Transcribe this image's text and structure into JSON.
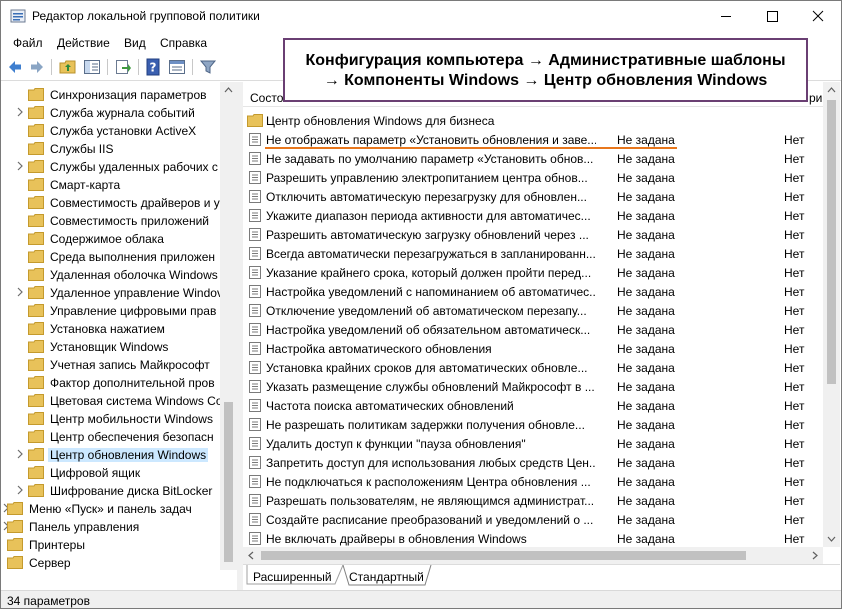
{
  "window": {
    "title": "Редактор локальной групповой политики",
    "minimize": "—",
    "maximize": "☐",
    "close": "✕"
  },
  "menu": [
    "Файл",
    "Действие",
    "Вид",
    "Справка"
  ],
  "annotation": {
    "line1": "Конфигурация компьютера → Административные шаблоны",
    "line2": "→ Компоненты Windows → Центр обновления Windows"
  },
  "tree": [
    {
      "label": "Синхронизация параметров",
      "expandable": false,
      "level": 2
    },
    {
      "label": "Служба журнала событий",
      "expandable": true,
      "level": 2
    },
    {
      "label": "Служба установки ActiveX",
      "expandable": false,
      "level": 2
    },
    {
      "label": "Службы IIS",
      "expandable": false,
      "level": 2
    },
    {
      "label": "Службы удаленных рабочих с",
      "expandable": true,
      "level": 2
    },
    {
      "label": "Смарт-карта",
      "expandable": false,
      "level": 2
    },
    {
      "label": "Совместимость драйверов и ус",
      "expandable": false,
      "level": 2
    },
    {
      "label": "Совместимость приложений",
      "expandable": false,
      "level": 2
    },
    {
      "label": "Содержимое облака",
      "expandable": false,
      "level": 2
    },
    {
      "label": "Среда выполнения приложен",
      "expandable": false,
      "level": 2
    },
    {
      "label": "Удаленная оболочка Windows",
      "expandable": false,
      "level": 2
    },
    {
      "label": "Удаленное управление Windov",
      "expandable": true,
      "level": 2
    },
    {
      "label": "Управление цифровыми прав",
      "expandable": false,
      "level": 2
    },
    {
      "label": "Установка нажатием",
      "expandable": false,
      "level": 2
    },
    {
      "label": "Установщик Windows",
      "expandable": false,
      "level": 2
    },
    {
      "label": "Учетная запись Майкрософт",
      "expandable": false,
      "level": 2
    },
    {
      "label": "Фактор дополнительной пров",
      "expandable": false,
      "level": 2
    },
    {
      "label": "Цветовая система Windows Co",
      "expandable": false,
      "level": 2
    },
    {
      "label": "Центр мобильности Windows",
      "expandable": false,
      "level": 2
    },
    {
      "label": "Центр обеспечения безопасн",
      "expandable": false,
      "level": 2
    },
    {
      "label": "Центр обновления Windows",
      "expandable": true,
      "level": 2,
      "selected": true
    },
    {
      "label": "Цифровой ящик",
      "expandable": false,
      "level": 2
    },
    {
      "label": "Шифрование диска BitLocker",
      "expandable": true,
      "level": 2
    },
    {
      "label": "Меню «Пуск» и панель задач",
      "expandable": true,
      "level": 1
    },
    {
      "label": "Панель управления",
      "expandable": true,
      "level": 1
    },
    {
      "label": "Принтеры",
      "expandable": false,
      "level": 1
    },
    {
      "label": "Сервер",
      "expandable": false,
      "level": 1
    }
  ],
  "list": {
    "headers": {
      "name": "Состо",
      "state": "",
      "comment": "ри"
    },
    "folder_row": "Центр обновления Windows для бизнеса",
    "rows": [
      {
        "name": "Не отображать параметр «Установить обновления и заве...",
        "state": "Не задана",
        "comment": "Нет"
      },
      {
        "name": "Не задавать по умолчанию параметр «Установить обнов...",
        "state": "Не задана",
        "comment": "Нет"
      },
      {
        "name": "Разрешить управлению электропитанием центра обнов...",
        "state": "Не задана",
        "comment": "Нет"
      },
      {
        "name": "Отключить автоматическую перезагрузку для обновлен...",
        "state": "Не задана",
        "comment": "Нет"
      },
      {
        "name": "Укажите диапазон периода активности для автоматичес...",
        "state": "Не задана",
        "comment": "Нет"
      },
      {
        "name": "Разрешить автоматическую загрузку обновлений через ...",
        "state": "Не задана",
        "comment": "Нет"
      },
      {
        "name": "Всегда автоматически перезагружаться в запланированн...",
        "state": "Не задана",
        "comment": "Нет"
      },
      {
        "name": "Указание крайнего срока, который должен пройти перед...",
        "state": "Не задана",
        "comment": "Нет"
      },
      {
        "name": "Настройка уведомлений с напоминанием об автоматичес...",
        "state": "Не задана",
        "comment": "Нет"
      },
      {
        "name": "Отключение уведомлений об автоматическом перезапу...",
        "state": "Не задана",
        "comment": "Нет"
      },
      {
        "name": "Настройка уведомлений об обязательном автоматическ...",
        "state": "Не задана",
        "comment": "Нет"
      },
      {
        "name": "Настройка автоматического обновления",
        "state": "Не задана",
        "comment": "Нет"
      },
      {
        "name": "Установка крайних сроков для автоматических обновле...",
        "state": "Не задана",
        "comment": "Нет"
      },
      {
        "name": "Указать размещение службы обновлений Майкрософт в ...",
        "state": "Не задана",
        "comment": "Нет"
      },
      {
        "name": "Частота поиска автоматических обновлений",
        "state": "Не задана",
        "comment": "Нет"
      },
      {
        "name": "Не разрешать политикам задержки получения обновле...",
        "state": "Не задана",
        "comment": "Нет"
      },
      {
        "name": "Удалить доступ к функции \"пауза обновления\"",
        "state": "Не задана",
        "comment": "Нет"
      },
      {
        "name": "Запретить доступ для использования любых средств Цен...",
        "state": "Не задана",
        "comment": "Нет"
      },
      {
        "name": "Не подключаться к расположениям Центра обновления ...",
        "state": "Не задана",
        "comment": "Нет"
      },
      {
        "name": "Разрешать пользователям, не являющимся администрат...",
        "state": "Не задана",
        "comment": "Нет"
      },
      {
        "name": "Создайте расписание преобразований и уведомлений о ...",
        "state": "Не задана",
        "comment": "Нет"
      },
      {
        "name": "Не включать драйверы в обновления Windows",
        "state": "Не задана",
        "comment": "Нет"
      }
    ]
  },
  "tabs": [
    "Расширенный",
    "Стандартный"
  ],
  "status": "34 параметров",
  "colors": {
    "accent_orange": "#e8771c",
    "annotation_border": "#6a3f73",
    "selection": "#cce8ff",
    "folder": "#e8c25a"
  }
}
